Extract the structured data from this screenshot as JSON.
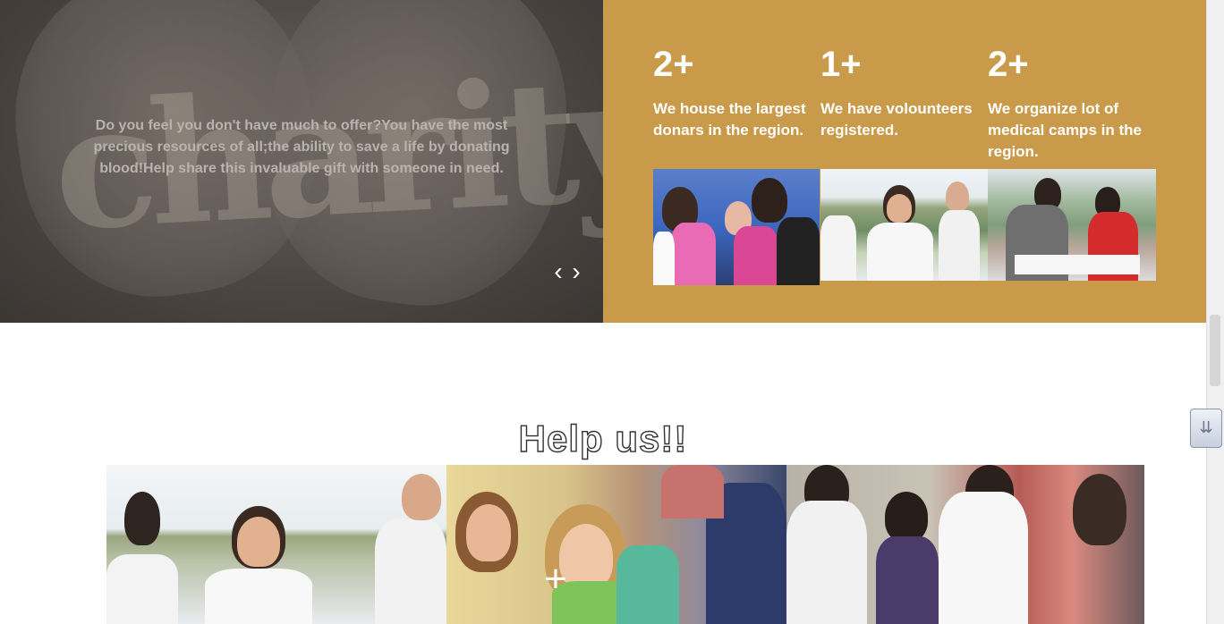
{
  "hero": {
    "text": "Do you feel you don't have much to offer?You have the most precious resources of all;the ability to save a life by donating blood!Help share this invaluable gift with someone in need.",
    "prev_label": "‹",
    "next_label": "›"
  },
  "stats": [
    {
      "number": "2+",
      "description": "We house the largest donars in the region."
    },
    {
      "number": "1+",
      "description": "We have volounteers registered."
    },
    {
      "number": "2+",
      "description": "We organize lot of medical camps in the region."
    }
  ],
  "help": {
    "title": "Help us!!",
    "plus_label": "+"
  },
  "colors": {
    "accent": "#c99a4a",
    "hero_dark": "#4c4743"
  }
}
